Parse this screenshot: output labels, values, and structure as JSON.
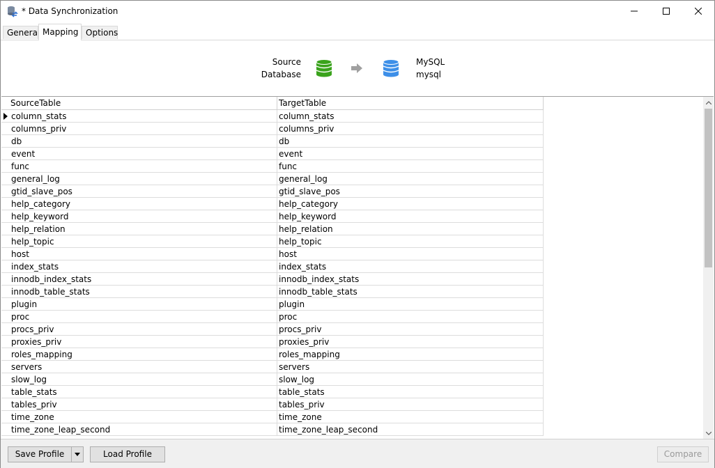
{
  "window": {
    "title": "* Data Synchronization"
  },
  "tabs": [
    {
      "label": "General"
    },
    {
      "label": "Mapping"
    },
    {
      "label": "Options"
    }
  ],
  "mapping": {
    "source_label_line1": "Source",
    "source_label_line2": "Database",
    "target_label_line1": "MySQL",
    "target_label_line2": "mysql",
    "source_icon": "database-green-icon",
    "target_icon": "database-blue-icon",
    "arrow_icon": "arrow-right-icon"
  },
  "grid": {
    "columns": [
      "SourceTable",
      "TargetTable"
    ],
    "rows": [
      [
        "column_stats",
        "column_stats"
      ],
      [
        "columns_priv",
        "columns_priv"
      ],
      [
        "db",
        "db"
      ],
      [
        "event",
        "event"
      ],
      [
        "func",
        "func"
      ],
      [
        "general_log",
        "general_log"
      ],
      [
        "gtid_slave_pos",
        "gtid_slave_pos"
      ],
      [
        "help_category",
        "help_category"
      ],
      [
        "help_keyword",
        "help_keyword"
      ],
      [
        "help_relation",
        "help_relation"
      ],
      [
        "help_topic",
        "help_topic"
      ],
      [
        "host",
        "host"
      ],
      [
        "index_stats",
        "index_stats"
      ],
      [
        "innodb_index_stats",
        "innodb_index_stats"
      ],
      [
        "innodb_table_stats",
        "innodb_table_stats"
      ],
      [
        "plugin",
        "plugin"
      ],
      [
        "proc",
        "proc"
      ],
      [
        "procs_priv",
        "procs_priv"
      ],
      [
        "proxies_priv",
        "proxies_priv"
      ],
      [
        "roles_mapping",
        "roles_mapping"
      ],
      [
        "servers",
        "servers"
      ],
      [
        "slow_log",
        "slow_log"
      ],
      [
        "table_stats",
        "table_stats"
      ],
      [
        "tables_priv",
        "tables_priv"
      ],
      [
        "time_zone",
        "time_zone"
      ],
      [
        "time_zone_leap_second",
        "time_zone_leap_second"
      ]
    ]
  },
  "footer": {
    "save_label": "Save Profile",
    "load_label": "Load Profile",
    "compare_label": "Compare"
  },
  "colors": {
    "source_db": "#3aa31c",
    "target_db": "#3d8fe8",
    "arrow": "#a0a0a0"
  }
}
